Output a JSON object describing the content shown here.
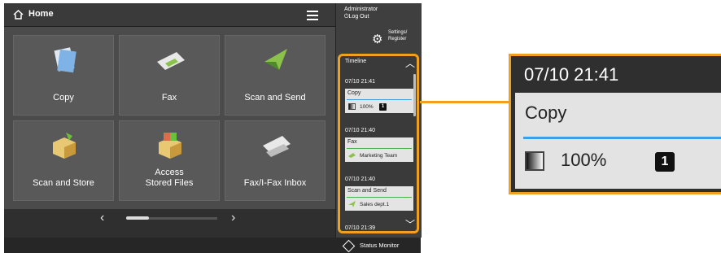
{
  "header": {
    "home_label": "Home"
  },
  "tiles": [
    {
      "label": "Copy",
      "icon": "copy-icon"
    },
    {
      "label": "Fax",
      "icon": "fax-icon"
    },
    {
      "label": "Scan and Send",
      "icon": "scan-send-icon"
    },
    {
      "label": "Scan and Store",
      "icon": "scan-store-icon"
    },
    {
      "label_line1": "Access",
      "label_line2": "Stored Files",
      "icon": "stored-files-icon"
    },
    {
      "label": "Fax/I-Fax Inbox",
      "icon": "fax-inbox-icon"
    }
  ],
  "side": {
    "admin": "Administrator",
    "logout": "Log Out",
    "settings_line1": "Settings/",
    "settings_line2": "Register"
  },
  "timeline": {
    "title": "Timeline",
    "entries": [
      {
        "time": "07/10 21:41",
        "title": "Copy",
        "detail": "100%",
        "badge": "1",
        "line_color": "#3aa0e8"
      },
      {
        "time": "07/10 21:40",
        "title": "Fax",
        "detail": "Marketing Team",
        "line_color": "#4caf50"
      },
      {
        "time": "07/10 21:40",
        "title": "Scan and Send",
        "detail": "Sales dept.1",
        "line_color": "#4caf50"
      },
      {
        "time": "07/10 21:39"
      }
    ]
  },
  "status_monitor": {
    "label": "Status Monitor"
  },
  "zoom": {
    "time": "07/10 21:41",
    "title": "Copy",
    "percent": "100%",
    "badge": "1"
  },
  "colors": {
    "highlight": "#f0a01e",
    "copy_line": "#3aa0e8",
    "fax_line": "#4caf50"
  }
}
